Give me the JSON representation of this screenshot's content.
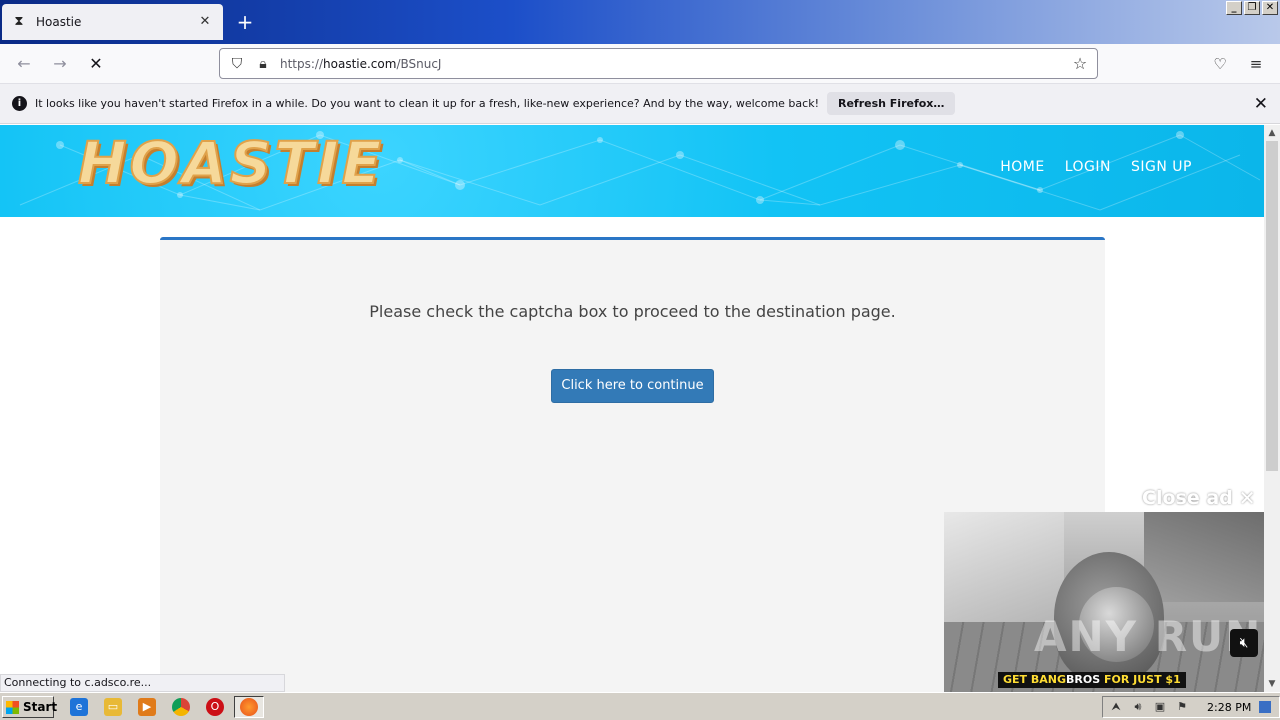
{
  "browser": {
    "tab_title": "Hoastie",
    "url_prefix": "https://",
    "url_host": "hoastie.com",
    "url_path": "/BSnucJ",
    "status_text": "Connecting to c.adsco.re..."
  },
  "notification": {
    "message": "It looks like you haven't started Firefox in a while. Do you want to clean it up for a fresh, like-new experience? And by the way, welcome back!",
    "button_label": "Refresh Firefox…"
  },
  "site": {
    "logo": "HOASTIE",
    "nav": [
      "HOME",
      "LOGIN",
      "SIGN UP"
    ],
    "captcha_message": "Please check the captcha box to proceed to the destination page.",
    "continue_label": "Click here to continue",
    "accent_color": "#337ab7",
    "header_color": "#12c3f5"
  },
  "ad": {
    "close_label": "Close ad",
    "banner_part1": "GET BANG",
    "banner_part2": "BROS",
    "banner_part3": " FOR JUST $1",
    "watermark": "ANY RUN"
  },
  "taskbar": {
    "start_label": "Start",
    "clock": "2:28 PM"
  }
}
